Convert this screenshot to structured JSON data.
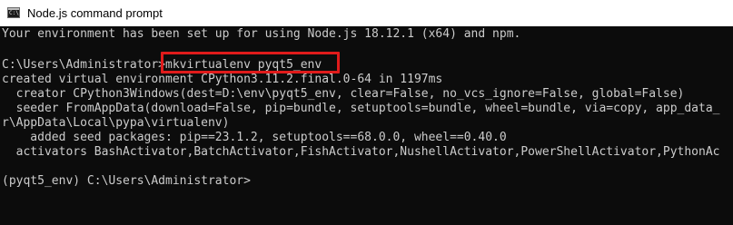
{
  "window": {
    "title": "Node.js command prompt",
    "icon": "console-app-icon",
    "icon_glyph": "C:\\"
  },
  "console": {
    "lines": [
      "Your environment has been set up for using Node.js 18.12.1 (x64) and npm.",
      "",
      "C:\\Users\\Administrator>mkvirtualenv pyqt5_env",
      "created virtual environment CPython3.11.2.final.0-64 in 1197ms",
      "  creator CPython3Windows(dest=D:\\env\\pyqt5_env, clear=False, no_vcs_ignore=False, global=False)",
      "  seeder FromAppData(download=False, pip=bundle, setuptools=bundle, wheel=bundle, via=copy, app_data_",
      "r\\AppData\\Local\\pypa\\virtualenv)",
      "    added seed packages: pip==23.1.2, setuptools==68.0.0, wheel==0.40.0",
      "  activators BashActivator,BatchActivator,FishActivator,NushellActivator,PowerShellActivator,PythonAc",
      "",
      "(pyqt5_env) C:\\Users\\Administrator>"
    ],
    "highlighted_command": "mkvirtualenv pyqt5_env"
  },
  "colors": {
    "console_background": "#0c0c0c",
    "console_text": "#cccccc",
    "titlebar_background": "#ffffff",
    "annotation_border": "#e01b1b"
  }
}
